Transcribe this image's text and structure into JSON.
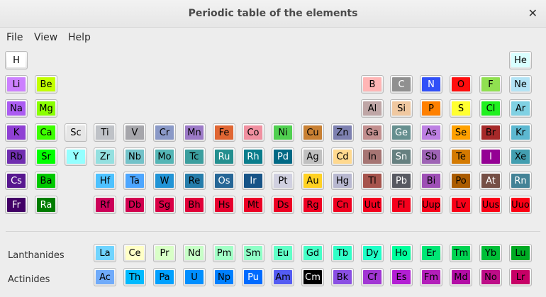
{
  "window": {
    "title": "Periodic table of the elements"
  },
  "menu": [
    {
      "label": "File"
    },
    {
      "label": "View"
    },
    {
      "label": "Help"
    }
  ],
  "labels": {
    "lanthanides": "Lanthanides",
    "actinides": "Actinides"
  },
  "elements": [
    {
      "s": "H",
      "r": 0,
      "c": 0,
      "bg": "#ffffff",
      "fg": "#000"
    },
    {
      "s": "He",
      "r": 0,
      "c": 17,
      "bg": "#d9ffff",
      "fg": "#000"
    },
    {
      "s": "Li",
      "r": 1,
      "c": 0,
      "bg": "#cc80ff",
      "fg": "#000"
    },
    {
      "s": "Be",
      "r": 1,
      "c": 1,
      "bg": "#c2ff00",
      "fg": "#000"
    },
    {
      "s": "B",
      "r": 1,
      "c": 12,
      "bg": "#ffb5b5",
      "fg": "#000"
    },
    {
      "s": "C",
      "r": 1,
      "c": 13,
      "bg": "#909090",
      "fg": "#fff"
    },
    {
      "s": "N",
      "r": 1,
      "c": 14,
      "bg": "#3050f8",
      "fg": "#fff"
    },
    {
      "s": "O",
      "r": 1,
      "c": 15,
      "bg": "#ff0d0d",
      "fg": "#000"
    },
    {
      "s": "F",
      "r": 1,
      "c": 16,
      "bg": "#90e050",
      "fg": "#000"
    },
    {
      "s": "Ne",
      "r": 1,
      "c": 17,
      "bg": "#b3e3f5",
      "fg": "#000"
    },
    {
      "s": "Na",
      "r": 2,
      "c": 0,
      "bg": "#ab5cf2",
      "fg": "#000"
    },
    {
      "s": "Mg",
      "r": 2,
      "c": 1,
      "bg": "#8aff00",
      "fg": "#000"
    },
    {
      "s": "Al",
      "r": 2,
      "c": 12,
      "bg": "#bfa6a6",
      "fg": "#000"
    },
    {
      "s": "Si",
      "r": 2,
      "c": 13,
      "bg": "#f0c8a0",
      "fg": "#000"
    },
    {
      "s": "P",
      "r": 2,
      "c": 14,
      "bg": "#ff8000",
      "fg": "#000"
    },
    {
      "s": "S",
      "r": 2,
      "c": 15,
      "bg": "#ffff30",
      "fg": "#000"
    },
    {
      "s": "Cl",
      "r": 2,
      "c": 16,
      "bg": "#1ff01f",
      "fg": "#000"
    },
    {
      "s": "Ar",
      "r": 2,
      "c": 17,
      "bg": "#80d1e3",
      "fg": "#000"
    },
    {
      "s": "K",
      "r": 3,
      "c": 0,
      "bg": "#8f40d4",
      "fg": "#000"
    },
    {
      "s": "Ca",
      "r": 3,
      "c": 1,
      "bg": "#3dff00",
      "fg": "#000"
    },
    {
      "s": "Sc",
      "r": 3,
      "c": 2,
      "bg": "#e6e6e6",
      "fg": "#000"
    },
    {
      "s": "Ti",
      "r": 3,
      "c": 3,
      "bg": "#bfc2c7",
      "fg": "#000"
    },
    {
      "s": "V",
      "r": 3,
      "c": 4,
      "bg": "#a6a6ab",
      "fg": "#000"
    },
    {
      "s": "Cr",
      "r": 3,
      "c": 5,
      "bg": "#8a99c7",
      "fg": "#000"
    },
    {
      "s": "Mn",
      "r": 3,
      "c": 6,
      "bg": "#9c7ac7",
      "fg": "#000"
    },
    {
      "s": "Fe",
      "r": 3,
      "c": 7,
      "bg": "#e06633",
      "fg": "#000"
    },
    {
      "s": "Co",
      "r": 3,
      "c": 8,
      "bg": "#f090a0",
      "fg": "#000"
    },
    {
      "s": "Ni",
      "r": 3,
      "c": 9,
      "bg": "#50d050",
      "fg": "#000"
    },
    {
      "s": "Cu",
      "r": 3,
      "c": 10,
      "bg": "#c88033",
      "fg": "#000"
    },
    {
      "s": "Zn",
      "r": 3,
      "c": 11,
      "bg": "#7d80b0",
      "fg": "#000"
    },
    {
      "s": "Ga",
      "r": 3,
      "c": 12,
      "bg": "#c28f8f",
      "fg": "#000"
    },
    {
      "s": "Ge",
      "r": 3,
      "c": 13,
      "bg": "#668f8f",
      "fg": "#fff"
    },
    {
      "s": "As",
      "r": 3,
      "c": 14,
      "bg": "#bd80e3",
      "fg": "#000"
    },
    {
      "s": "Se",
      "r": 3,
      "c": 15,
      "bg": "#ffa100",
      "fg": "#000"
    },
    {
      "s": "Br",
      "r": 3,
      "c": 16,
      "bg": "#a62929",
      "fg": "#000"
    },
    {
      "s": "Kr",
      "r": 3,
      "c": 17,
      "bg": "#5cb8d1",
      "fg": "#000"
    },
    {
      "s": "Rb",
      "r": 4,
      "c": 0,
      "bg": "#702eb0",
      "fg": "#000"
    },
    {
      "s": "Sr",
      "r": 4,
      "c": 1,
      "bg": "#00ff00",
      "fg": "#000"
    },
    {
      "s": "Y",
      "r": 4,
      "c": 2,
      "bg": "#94ffff",
      "fg": "#000"
    },
    {
      "s": "Zr",
      "r": 4,
      "c": 3,
      "bg": "#94e0e0",
      "fg": "#000"
    },
    {
      "s": "Nb",
      "r": 4,
      "c": 4,
      "bg": "#73c2c9",
      "fg": "#000"
    },
    {
      "s": "Mo",
      "r": 4,
      "c": 5,
      "bg": "#54b5b5",
      "fg": "#000"
    },
    {
      "s": "Tc",
      "r": 4,
      "c": 6,
      "bg": "#3b9e9e",
      "fg": "#000"
    },
    {
      "s": "Ru",
      "r": 4,
      "c": 7,
      "bg": "#248f8f",
      "fg": "#fff"
    },
    {
      "s": "Rh",
      "r": 4,
      "c": 8,
      "bg": "#0a7d8c",
      "fg": "#fff"
    },
    {
      "s": "Pd",
      "r": 4,
      "c": 9,
      "bg": "#006985",
      "fg": "#fff"
    },
    {
      "s": "Ag",
      "r": 4,
      "c": 10,
      "bg": "#c0c0c0",
      "fg": "#000"
    },
    {
      "s": "Cd",
      "r": 4,
      "c": 11,
      "bg": "#ffd98f",
      "fg": "#000"
    },
    {
      "s": "In",
      "r": 4,
      "c": 12,
      "bg": "#a67573",
      "fg": "#000"
    },
    {
      "s": "Sn",
      "r": 4,
      "c": 13,
      "bg": "#668080",
      "fg": "#fff"
    },
    {
      "s": "Sb",
      "r": 4,
      "c": 14,
      "bg": "#9e63b5",
      "fg": "#000"
    },
    {
      "s": "Te",
      "r": 4,
      "c": 15,
      "bg": "#d47a00",
      "fg": "#000"
    },
    {
      "s": "I",
      "r": 4,
      "c": 16,
      "bg": "#940094",
      "fg": "#fff"
    },
    {
      "s": "Xe",
      "r": 4,
      "c": 17,
      "bg": "#429eb0",
      "fg": "#000"
    },
    {
      "s": "Cs",
      "r": 5,
      "c": 0,
      "bg": "#57178f",
      "fg": "#fff"
    },
    {
      "s": "Ba",
      "r": 5,
      "c": 1,
      "bg": "#00c900",
      "fg": "#000"
    },
    {
      "s": "Hf",
      "r": 5,
      "c": 3,
      "bg": "#4dc2ff",
      "fg": "#000"
    },
    {
      "s": "Ta",
      "r": 5,
      "c": 4,
      "bg": "#4da6ff",
      "fg": "#000"
    },
    {
      "s": "W",
      "r": 5,
      "c": 5,
      "bg": "#2194d6",
      "fg": "#000"
    },
    {
      "s": "Re",
      "r": 5,
      "c": 6,
      "bg": "#267dab",
      "fg": "#000"
    },
    {
      "s": "Os",
      "r": 5,
      "c": 7,
      "bg": "#266696",
      "fg": "#fff"
    },
    {
      "s": "Ir",
      "r": 5,
      "c": 8,
      "bg": "#175487",
      "fg": "#fff"
    },
    {
      "s": "Pt",
      "r": 5,
      "c": 9,
      "bg": "#d0d0e0",
      "fg": "#000"
    },
    {
      "s": "Au",
      "r": 5,
      "c": 10,
      "bg": "#ffd123",
      "fg": "#000"
    },
    {
      "s": "Hg",
      "r": 5,
      "c": 11,
      "bg": "#b8b8d0",
      "fg": "#000"
    },
    {
      "s": "Tl",
      "r": 5,
      "c": 12,
      "bg": "#a6544d",
      "fg": "#000"
    },
    {
      "s": "Pb",
      "r": 5,
      "c": 13,
      "bg": "#575961",
      "fg": "#fff"
    },
    {
      "s": "Bi",
      "r": 5,
      "c": 14,
      "bg": "#9e4fb5",
      "fg": "#000"
    },
    {
      "s": "Po",
      "r": 5,
      "c": 15,
      "bg": "#ab5c00",
      "fg": "#000"
    },
    {
      "s": "At",
      "r": 5,
      "c": 16,
      "bg": "#754f45",
      "fg": "#fff"
    },
    {
      "s": "Rn",
      "r": 5,
      "c": 17,
      "bg": "#428296",
      "fg": "#fff"
    },
    {
      "s": "Fr",
      "r": 6,
      "c": 0,
      "bg": "#420066",
      "fg": "#fff"
    },
    {
      "s": "Ra",
      "r": 6,
      "c": 1,
      "bg": "#007d00",
      "fg": "#fff"
    },
    {
      "s": "Rf",
      "r": 6,
      "c": 3,
      "bg": "#cc0059",
      "fg": "#000"
    },
    {
      "s": "Db",
      "r": 6,
      "c": 4,
      "bg": "#d1004f",
      "fg": "#000"
    },
    {
      "s": "Sg",
      "r": 6,
      "c": 5,
      "bg": "#d90045",
      "fg": "#000"
    },
    {
      "s": "Bh",
      "r": 6,
      "c": 6,
      "bg": "#e00038",
      "fg": "#000"
    },
    {
      "s": "Hs",
      "r": 6,
      "c": 7,
      "bg": "#e6002e",
      "fg": "#000"
    },
    {
      "s": "Mt",
      "r": 6,
      "c": 8,
      "bg": "#eb0026",
      "fg": "#000"
    },
    {
      "s": "Ds",
      "r": 6,
      "c": 9,
      "bg": "#ed0024",
      "fg": "#000"
    },
    {
      "s": "Rg",
      "r": 6,
      "c": 10,
      "bg": "#ef0022",
      "fg": "#000"
    },
    {
      "s": "Cn",
      "r": 6,
      "c": 11,
      "bg": "#f00020",
      "fg": "#000"
    },
    {
      "s": "Uut",
      "r": 6,
      "c": 12,
      "bg": "#f2001e",
      "fg": "#000"
    },
    {
      "s": "Fl",
      "r": 6,
      "c": 13,
      "bg": "#f4001c",
      "fg": "#000"
    },
    {
      "s": "Uup",
      "r": 6,
      "c": 14,
      "bg": "#f6001a",
      "fg": "#000"
    },
    {
      "s": "Lv",
      "r": 6,
      "c": 15,
      "bg": "#f80018",
      "fg": "#000"
    },
    {
      "s": "Uus",
      "r": 6,
      "c": 16,
      "bg": "#fa0016",
      "fg": "#000"
    },
    {
      "s": "Uuo",
      "r": 6,
      "c": 17,
      "bg": "#fc0014",
      "fg": "#000"
    },
    {
      "s": "La",
      "r": 7,
      "c": 3,
      "bg": "#70d4ff",
      "fg": "#000"
    },
    {
      "s": "Ce",
      "r": 7,
      "c": 4,
      "bg": "#ffffc7",
      "fg": "#000"
    },
    {
      "s": "Pr",
      "r": 7,
      "c": 5,
      "bg": "#d9ffc7",
      "fg": "#000"
    },
    {
      "s": "Nd",
      "r": 7,
      "c": 6,
      "bg": "#c7ffc7",
      "fg": "#000"
    },
    {
      "s": "Pm",
      "r": 7,
      "c": 7,
      "bg": "#a3ffc7",
      "fg": "#000"
    },
    {
      "s": "Sm",
      "r": 7,
      "c": 8,
      "bg": "#8fffc7",
      "fg": "#000"
    },
    {
      "s": "Eu",
      "r": 7,
      "c": 9,
      "bg": "#61ffc7",
      "fg": "#000"
    },
    {
      "s": "Gd",
      "r": 7,
      "c": 10,
      "bg": "#45ffc7",
      "fg": "#000"
    },
    {
      "s": "Tb",
      "r": 7,
      "c": 11,
      "bg": "#30ffc7",
      "fg": "#000"
    },
    {
      "s": "Dy",
      "r": 7,
      "c": 12,
      "bg": "#1fffc7",
      "fg": "#000"
    },
    {
      "s": "Ho",
      "r": 7,
      "c": 13,
      "bg": "#00ff9c",
      "fg": "#000"
    },
    {
      "s": "Er",
      "r": 7,
      "c": 14,
      "bg": "#00e675",
      "fg": "#000"
    },
    {
      "s": "Tm",
      "r": 7,
      "c": 15,
      "bg": "#00d452",
      "fg": "#000"
    },
    {
      "s": "Yb",
      "r": 7,
      "c": 16,
      "bg": "#00bf38",
      "fg": "#000"
    },
    {
      "s": "Lu",
      "r": 7,
      "c": 17,
      "bg": "#00ab24",
      "fg": "#000"
    },
    {
      "s": "Ac",
      "r": 8,
      "c": 3,
      "bg": "#70abfa",
      "fg": "#000"
    },
    {
      "s": "Th",
      "r": 8,
      "c": 4,
      "bg": "#00baff",
      "fg": "#000"
    },
    {
      "s": "Pa",
      "r": 8,
      "c": 5,
      "bg": "#00a1ff",
      "fg": "#000"
    },
    {
      "s": "U",
      "r": 8,
      "c": 6,
      "bg": "#008fff",
      "fg": "#000"
    },
    {
      "s": "Np",
      "r": 8,
      "c": 7,
      "bg": "#0080ff",
      "fg": "#000"
    },
    {
      "s": "Pu",
      "r": 8,
      "c": 8,
      "bg": "#006bff",
      "fg": "#fff"
    },
    {
      "s": "Am",
      "r": 8,
      "c": 9,
      "bg": "#545cf2",
      "fg": "#000"
    },
    {
      "s": "Cm",
      "r": 8,
      "c": 10,
      "bg": "#000000",
      "fg": "#fff"
    },
    {
      "s": "Bk",
      "r": 8,
      "c": 11,
      "bg": "#8a4fe3",
      "fg": "#000"
    },
    {
      "s": "Cf",
      "r": 8,
      "c": 12,
      "bg": "#a136d4",
      "fg": "#000"
    },
    {
      "s": "Es",
      "r": 8,
      "c": 13,
      "bg": "#b31fd4",
      "fg": "#000"
    },
    {
      "s": "Fm",
      "r": 8,
      "c": 14,
      "bg": "#b31fba",
      "fg": "#000"
    },
    {
      "s": "Md",
      "r": 8,
      "c": 15,
      "bg": "#b30da6",
      "fg": "#000"
    },
    {
      "s": "No",
      "r": 8,
      "c": 16,
      "bg": "#bd0d87",
      "fg": "#000"
    },
    {
      "s": "Lr",
      "r": 8,
      "c": 17,
      "bg": "#c70066",
      "fg": "#000"
    }
  ]
}
